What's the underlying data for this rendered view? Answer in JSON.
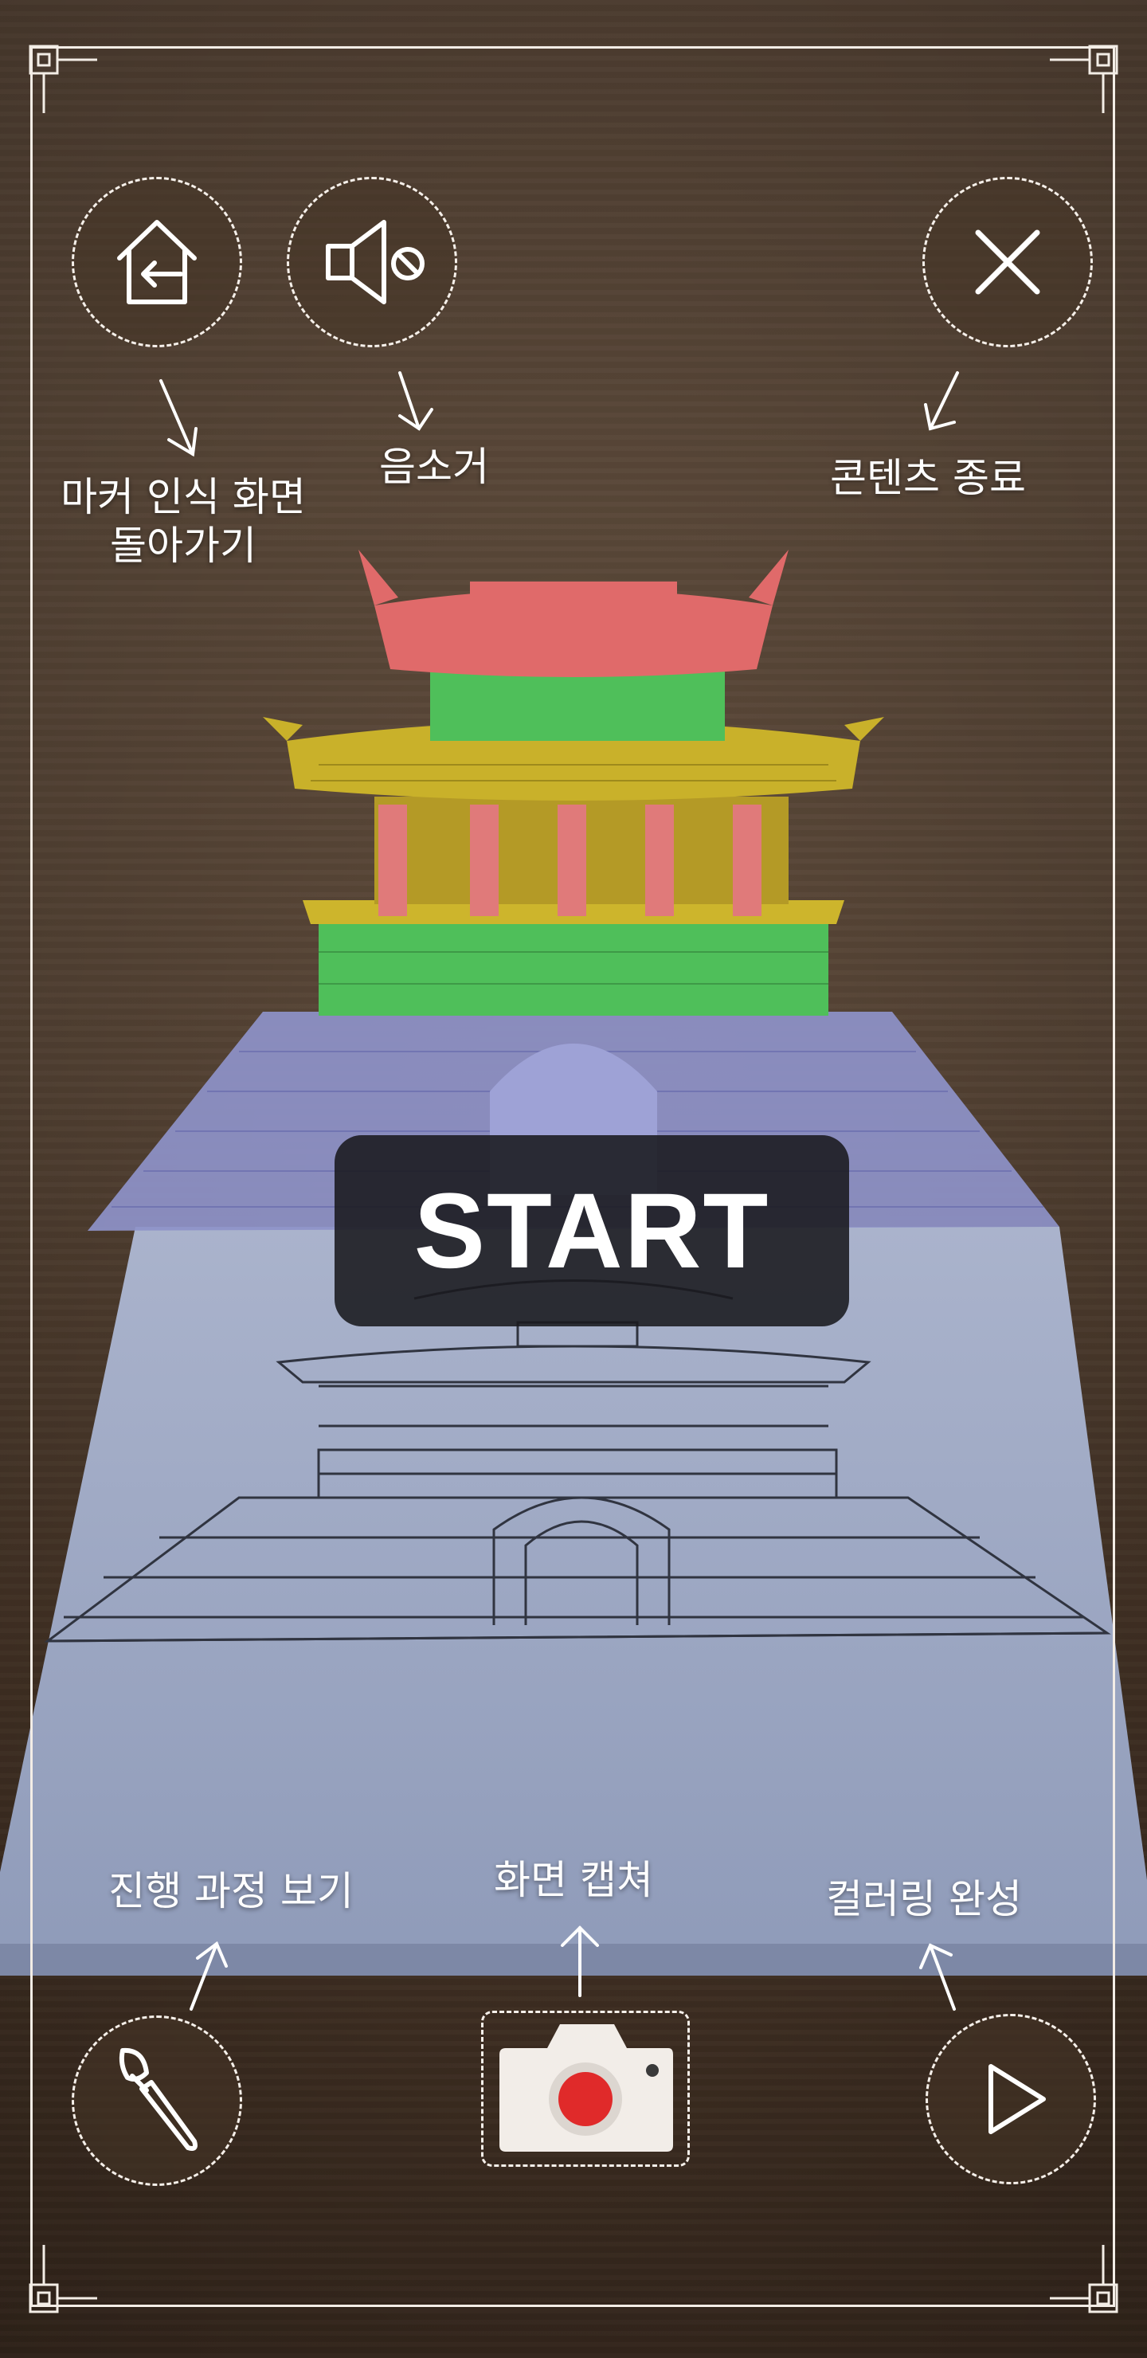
{
  "buttons": {
    "home": {
      "icon": "home-return-icon"
    },
    "mute": {
      "icon": "speaker-mute-icon"
    },
    "close": {
      "icon": "close-icon"
    },
    "progress": {
      "icon": "paintbrush-icon"
    },
    "capture": {
      "icon": "camera-icon"
    },
    "complete": {
      "icon": "play-icon"
    }
  },
  "labels": {
    "home": "마커 인식 화면\n돌아가기",
    "mute": "음소거",
    "close": "콘텐츠 종료",
    "progress": "진행 과정 보기",
    "capture": "화면 캡쳐",
    "complete": "컬러링 완성"
  },
  "start": {
    "label": "START"
  },
  "colors": {
    "frame": "#f3ede6",
    "roof_top": "#e06a6a",
    "body_green": "#4fbf5a",
    "roof_mid": "#c9b12a",
    "pillars": "#e07a7a",
    "wall": "#8e92c9",
    "record": "#e02a2a"
  }
}
